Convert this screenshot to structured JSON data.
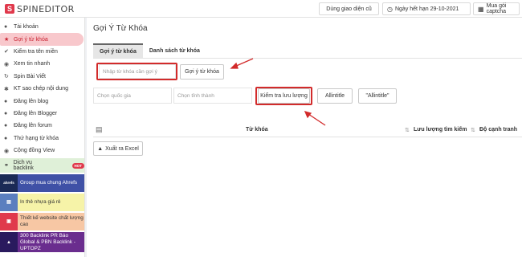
{
  "header": {
    "logo_letter": "S",
    "logo_text": "SPINEDITOR",
    "btn_old_ui": "Dùng giao diện cũ",
    "btn_expiry": "Ngày hết hạn 29-10-2021",
    "btn_captcha": "Mua gói captcha"
  },
  "sidebar": {
    "items": [
      {
        "icon": "user-icon",
        "label": "Tài khoản"
      },
      {
        "icon": "star-icon",
        "label": "Gợi ý từ khóa"
      },
      {
        "icon": "check-icon",
        "label": "Kiểm tra tên miền"
      },
      {
        "icon": "eye-icon",
        "label": "Xem tin nhanh"
      },
      {
        "icon": "refresh-icon",
        "label": "Spin Bài Viết"
      },
      {
        "icon": "lightbulb-icon",
        "label": "KT sao chép nội dung"
      },
      {
        "icon": "user-icon",
        "label": "Đăng lên blog"
      },
      {
        "icon": "user-icon",
        "label": "Đăng lên Blogger"
      },
      {
        "icon": "user-icon",
        "label": "Đăng lên forum"
      },
      {
        "icon": "user-icon",
        "label": "Thứ hạng từ khóa"
      },
      {
        "icon": "eye-icon",
        "label": "Cộng đồng View"
      }
    ],
    "backlink": {
      "label": "Dịch vụ backlink",
      "badge": "HOT"
    },
    "ads": [
      {
        "thumb": "ahrefs",
        "text": "Group mua chung Ahrefs",
        "bg": "#3f51a6",
        "color": "#ffffff"
      },
      {
        "thumb": "",
        "text": "In thẻ nhựa giá rẻ",
        "bg": "#f6f3a8",
        "color": "#333333"
      },
      {
        "thumb": "",
        "text": "Thiết kế website chất lượng cao",
        "bg": "#f7c7a4",
        "color": "#333333"
      },
      {
        "thumb": "",
        "text": "300 Backlink PR Báo Global & PBN Backlink - UPTOPZ",
        "bg": "#6a2d8e",
        "color": "#ffffff"
      }
    ]
  },
  "main": {
    "title": "Gợi Ý Từ Khóa",
    "tabs": [
      "Gợi ý từ khóa",
      "Danh sách từ khóa"
    ],
    "keyword_placeholder": "Nhập từ khóa cần gợi ý",
    "suggest_button": "Gợi ý từ khóa",
    "country_placeholder": "Chọn quốc gia",
    "city_placeholder": "Chọn tỉnh thành",
    "volume_button": "Kiểm tra lưu lượng",
    "allintitle_button": "Allintitle",
    "allintitle_quoted_button": "\"Allintitle\"",
    "columns": {
      "keyword": "Từ khóa",
      "volume": "Lưu lượng tìm kiếm",
      "competition": "Độ cạnh tranh"
    },
    "export_button": "Xuất ra Excel"
  },
  "colors": {
    "accent": "#c8202f",
    "highlight": "#d22b2b",
    "active_nav_bg": "#f8c8cc"
  }
}
